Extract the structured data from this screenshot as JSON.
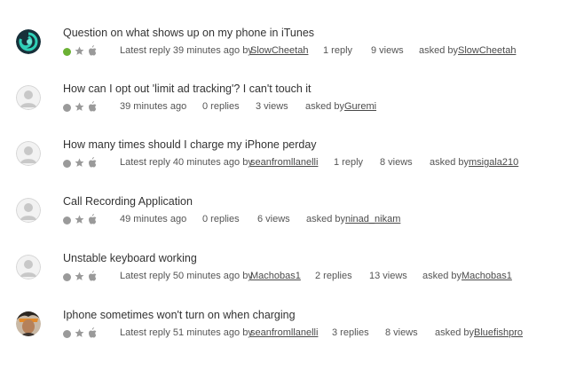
{
  "threads": [
    {
      "title": "Question on what shows up on my phone in iTunes",
      "solved": true,
      "avatar": "teal-swirl-avatar",
      "latest_prefix": "Latest reply 39 minutes ago by",
      "latest_user": "SlowCheetah",
      "replies": "1 reply",
      "views": "9 views",
      "asked_prefix": "asked by",
      "asked_user": "SlowCheetah"
    },
    {
      "title": "How can I opt out 'limit ad tracking'? I can't touch it",
      "solved": false,
      "avatar": "default-avatar",
      "latest_prefix": "39 minutes ago",
      "latest_user": "",
      "replies": "0 replies",
      "views": "3 views",
      "asked_prefix": "asked by",
      "asked_user": "Guremi"
    },
    {
      "title": "How many times should I charge my iPhone perday",
      "solved": false,
      "avatar": "default-avatar",
      "latest_prefix": "Latest reply 40 minutes ago by",
      "latest_user": "seanfromllanelli",
      "replies": "1 reply",
      "views": "8 views",
      "asked_prefix": "asked by",
      "asked_user": "msigala210"
    },
    {
      "title": "Call Recording Application",
      "solved": false,
      "avatar": "default-avatar",
      "latest_prefix": "49 minutes ago",
      "latest_user": "",
      "replies": "0 replies",
      "views": "6 views",
      "asked_prefix": "asked by",
      "asked_user": "ninad_nikam"
    },
    {
      "title": "Unstable keyboard working",
      "solved": false,
      "avatar": "default-avatar",
      "latest_prefix": "Latest reply 50 minutes ago by",
      "latest_user": "Machobas1",
      "replies": "2 replies",
      "views": "13 views",
      "asked_prefix": "asked by",
      "asked_user": "Machobas1"
    },
    {
      "title": "Iphone sometimes won't turn on when charging",
      "solved": false,
      "avatar": "photo-avatar",
      "latest_prefix": "Latest reply 51 minutes ago by",
      "latest_user": "seanfromllanelli",
      "replies": "3 replies",
      "views": "8 views",
      "asked_prefix": "asked by",
      "asked_user": "Bluefishpro"
    }
  ],
  "colors": {
    "solved_dot": "#6bb134",
    "unsolved_dot": "#9a9a9a",
    "icon_gray": "#9a9a9a"
  }
}
